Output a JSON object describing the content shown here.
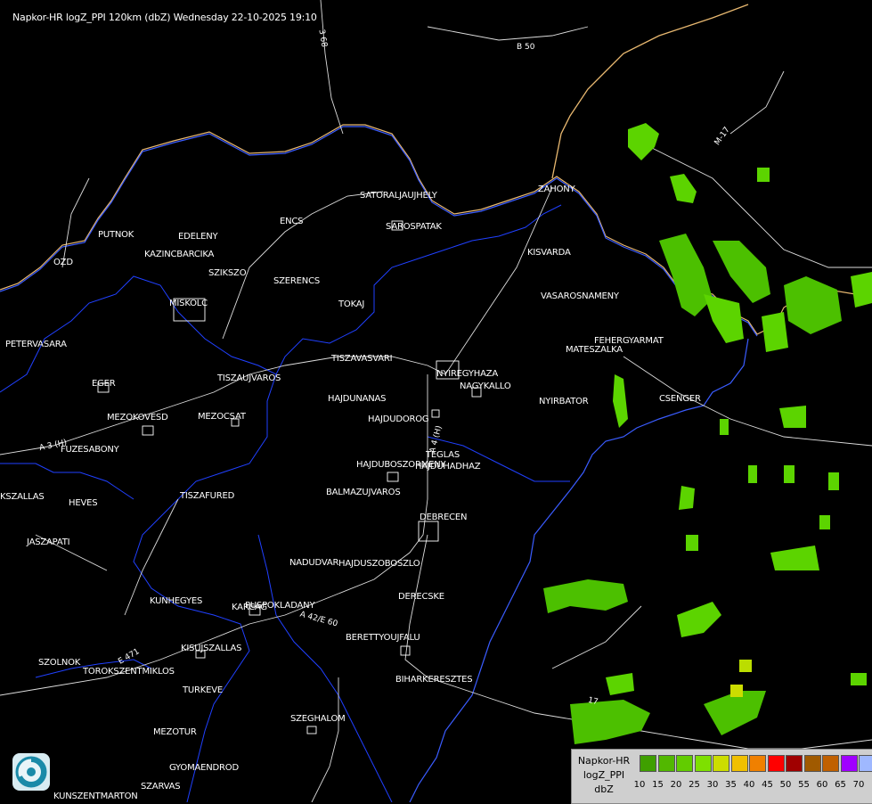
{
  "title": "Napkor-HR logZ_PPI 120km (dbZ) Wednesday 22-10-2025 19:10",
  "towns": [
    "SATORALJAUJHELY",
    "SAROSPATAK",
    "ZAHONY",
    "PUTNOK",
    "EDELENY",
    "ENCS",
    "KAZINCBARCIKA",
    "OZD",
    "SZIKSZO",
    "SZERENCS",
    "KISVARDA",
    "MISKOLC",
    "TOKAJ",
    "VASAROSNAMENY",
    "PETERVASARA",
    "FEHERGYARMAT",
    "MATESZALKA",
    "TISZAVASVARI",
    "NYIREGYHAZA",
    "EGER",
    "TISZAUJVAROS",
    "NAGYKALLO",
    "HAJDUNANAS",
    "NYIRBATOR",
    "CSENGER",
    "MEZOKOVESD",
    "MEZOCSAT",
    "HAJDUDOROG",
    "FUZESABONY",
    "TEGLAS",
    "HAJDUBOSZORMENY",
    "HAJDUHADHAZ",
    "BALMAZUJVAROS",
    "HEVES",
    "TISZAFURED",
    "KSZALLAS",
    "DEBRECEN",
    "JASZAPATI",
    "NADUDVAR",
    "HAJDUSZOBOSZLO",
    "KUNHEGYES",
    "DERECSKE",
    "KARCAG",
    "PUSPOKLADANY",
    "BERETTYOUJFALU",
    "KISUJSZALLAS",
    "SZOLNOK",
    "TOROKSZENTMIKLOS",
    "BIHARKERESZTES",
    "TURKEVE",
    "SZEGHALOM",
    "MEZOTUR",
    "GYOMAENDROD",
    "SZARVAS",
    "KUNSZENTMARTON"
  ],
  "roads": [
    "3 68",
    "B 50",
    "M-17",
    "A 3 (H)",
    "A 4 (H)",
    "A 42/E 60",
    "E 471",
    "17"
  ],
  "legend": {
    "labels": [
      "Napkor-HR",
      "logZ_PPI",
      "dbZ"
    ],
    "ticks": [
      "10",
      "15",
      "20",
      "25",
      "30",
      "35",
      "40",
      "45",
      "50",
      "55",
      "60",
      "65",
      "70"
    ],
    "colors": [
      "#3f9f00",
      "#52b800",
      "#62cc00",
      "#7ee000",
      "#ccdd00",
      "#f0c000",
      "#f08000",
      "#ff0000",
      "#a00000",
      "#a05a00",
      "#c06000",
      "#a000ff",
      "#9fb8ff"
    ]
  }
}
